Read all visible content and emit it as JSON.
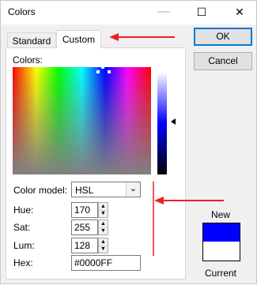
{
  "window": {
    "title": "Colors",
    "min_glyph": "—",
    "max_glyph": "☐",
    "close_glyph": "✕"
  },
  "tabs": [
    {
      "label": "Standard"
    },
    {
      "label": "Custom"
    }
  ],
  "custom": {
    "colors_label": "Colors:",
    "color_model_label": "Color model:",
    "color_model_value": "HSL",
    "hue_label": "Hue:",
    "hue_value": "170",
    "sat_label": "Sat:",
    "sat_value": "255",
    "lum_label": "Lum:",
    "lum_value": "128",
    "hex_label": "Hex:",
    "hex_value": "#0000FF"
  },
  "buttons": {
    "ok": "OK",
    "cancel": "Cancel"
  },
  "preview": {
    "new_label": "New",
    "current_label": "Current",
    "new_color": "#0000FF",
    "current_color": "#FFFFFF"
  },
  "annotation_color": "#e8202a"
}
